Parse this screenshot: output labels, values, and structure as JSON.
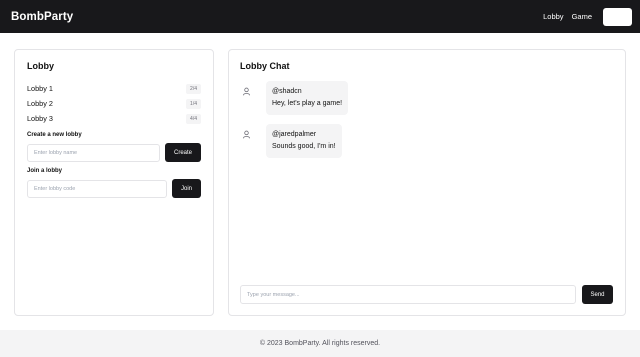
{
  "header": {
    "brand": "BombParty",
    "nav": [
      "Lobby",
      "Game"
    ]
  },
  "lobby": {
    "title": "Lobby",
    "lobbies": [
      {
        "name": "Lobby 1",
        "players": "2/4"
      },
      {
        "name": "Lobby 2",
        "players": "1/4"
      },
      {
        "name": "Lobby 3",
        "players": "4/4"
      }
    ],
    "create_label": "Create a new lobby",
    "create_placeholder": "Enter lobby name",
    "create_button": "Create",
    "join_label": "Join a lobby",
    "join_placeholder": "Enter lobby code",
    "join_button": "Join"
  },
  "chat": {
    "title": "Lobby Chat",
    "messages": [
      {
        "user": "@shadcn",
        "text": "Hey, let's play a game!"
      },
      {
        "user": "@jaredpalmer",
        "text": "Sounds good, I'm in!"
      }
    ],
    "input_placeholder": "Type your message...",
    "send_button": "Send"
  },
  "footer": {
    "text": "© 2023 BombParty. All rights reserved."
  },
  "colors": {
    "header_bg": "#18181b",
    "button_bg": "#18181b",
    "page_bg": "#f4f4f5",
    "border": "#e4e4e7"
  }
}
